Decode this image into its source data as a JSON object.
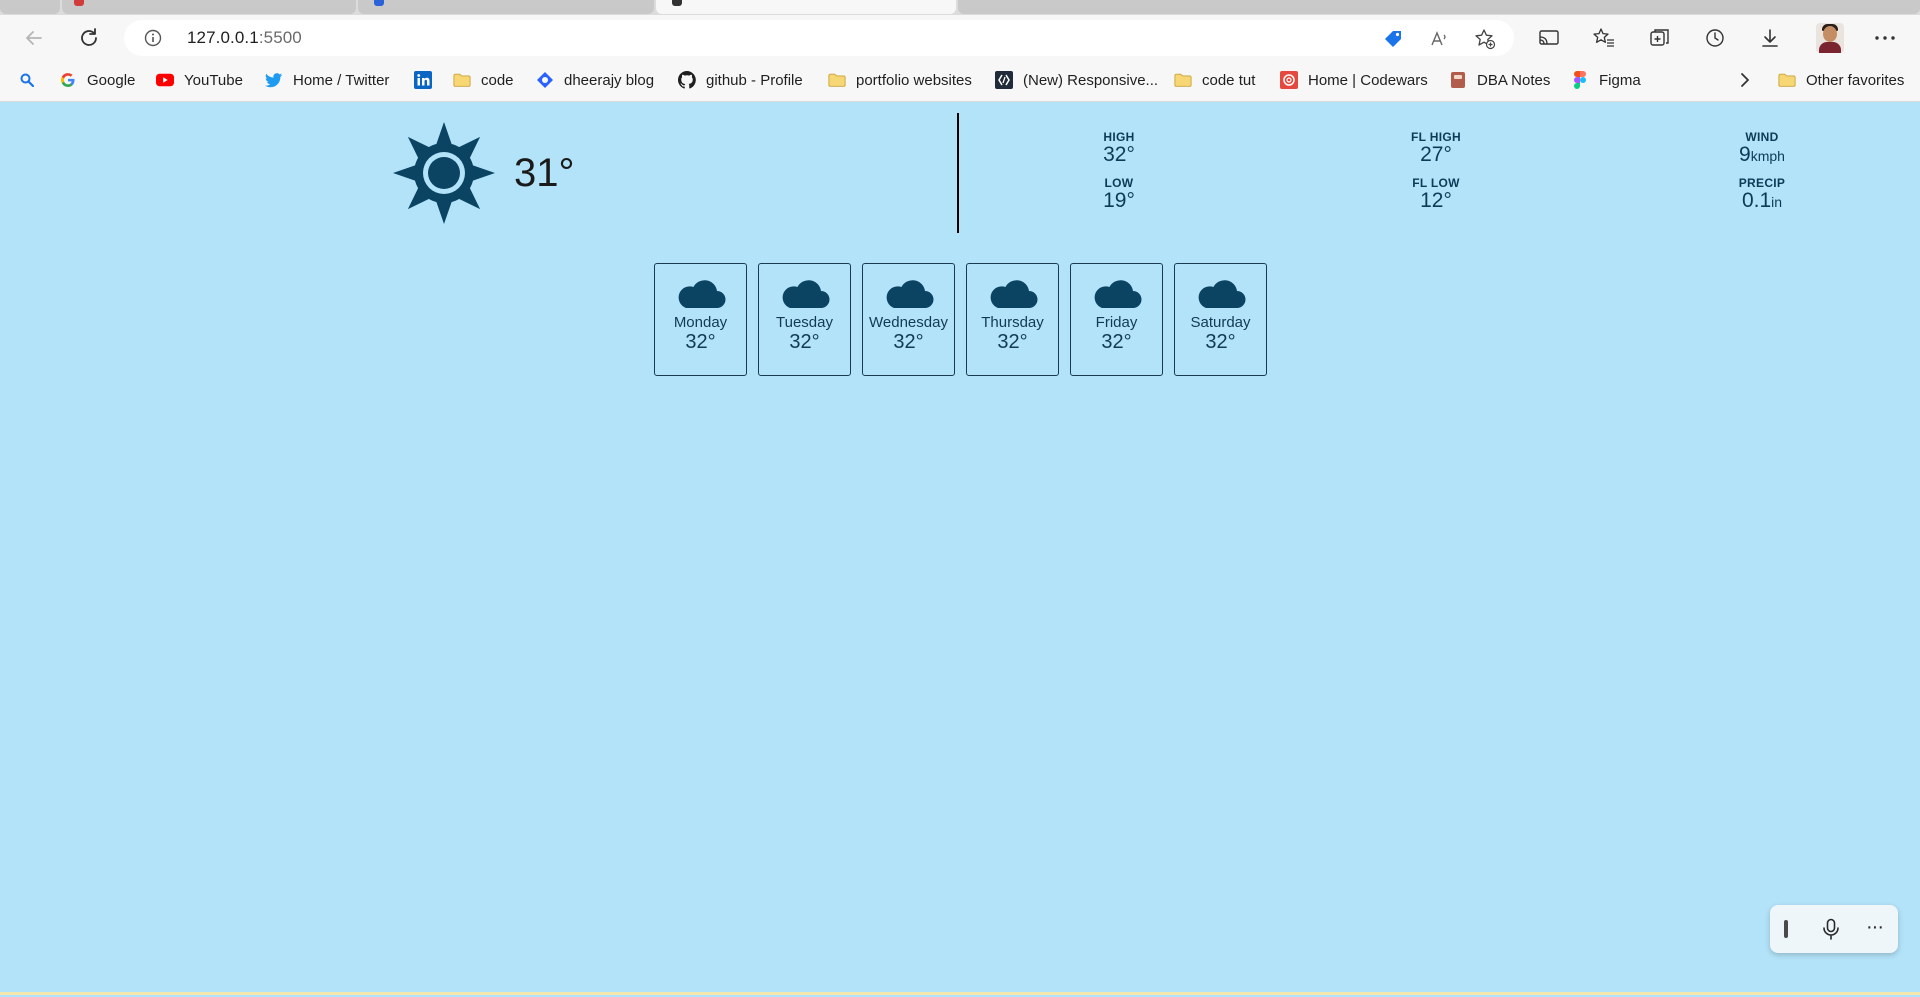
{
  "browser": {
    "url_host": "127.0.0.1",
    "url_port": ":5500",
    "bookmarks": [
      {
        "label": "Google",
        "icon": "google-icon"
      },
      {
        "label": "YouTube",
        "icon": "youtube-icon"
      },
      {
        "label": "Home / Twitter",
        "icon": "twitter-icon"
      },
      {
        "label": "",
        "icon": "linkedin-icon"
      },
      {
        "label": "code",
        "icon": "folder-icon"
      },
      {
        "label": "dheerajy blog",
        "icon": "hashnode-icon"
      },
      {
        "label": "github - Profile",
        "icon": "github-icon"
      },
      {
        "label": "portfolio websites",
        "icon": "folder-icon"
      },
      {
        "label": "(New) Responsive...",
        "icon": "frontendmentor-icon"
      },
      {
        "label": "code tut",
        "icon": "folder-icon"
      },
      {
        "label": "Home | Codewars",
        "icon": "codewars-icon"
      },
      {
        "label": "DBA Notes",
        "icon": "notes-icon"
      },
      {
        "label": "Figma",
        "icon": "figma-icon"
      },
      {
        "label": "Other favorites",
        "icon": "folder-icon"
      }
    ]
  },
  "weather": {
    "current": {
      "icon": "sun-icon",
      "temp": "31°"
    },
    "stats": {
      "high": {
        "label": "HIGH",
        "value": "32°"
      },
      "low": {
        "label": "LOW",
        "value": "19°"
      },
      "fl_high": {
        "label": "FL HIGH",
        "value": "27°"
      },
      "fl_low": {
        "label": "FL LOW",
        "value": "12°"
      },
      "wind": {
        "label": "WIND",
        "value": "9",
        "unit": "kmph"
      },
      "precip": {
        "label": "PRECIP",
        "value": "0.1",
        "unit": "in"
      }
    },
    "forecast": [
      {
        "day": "Monday",
        "temp": "32°",
        "icon": "cloud-icon"
      },
      {
        "day": "Tuesday",
        "temp": "32°",
        "icon": "cloud-icon"
      },
      {
        "day": "Wednesday",
        "temp": "32°",
        "icon": "cloud-icon"
      },
      {
        "day": "Thursday",
        "temp": "32°",
        "icon": "cloud-icon"
      },
      {
        "day": "Friday",
        "temp": "32°",
        "icon": "cloud-icon"
      },
      {
        "day": "Saturday",
        "temp": "32°",
        "icon": "cloud-icon"
      }
    ]
  },
  "colors": {
    "page_bg": "#b3e3f9",
    "icon_color": "#0b4463",
    "text_dark": "#0b3b57"
  }
}
